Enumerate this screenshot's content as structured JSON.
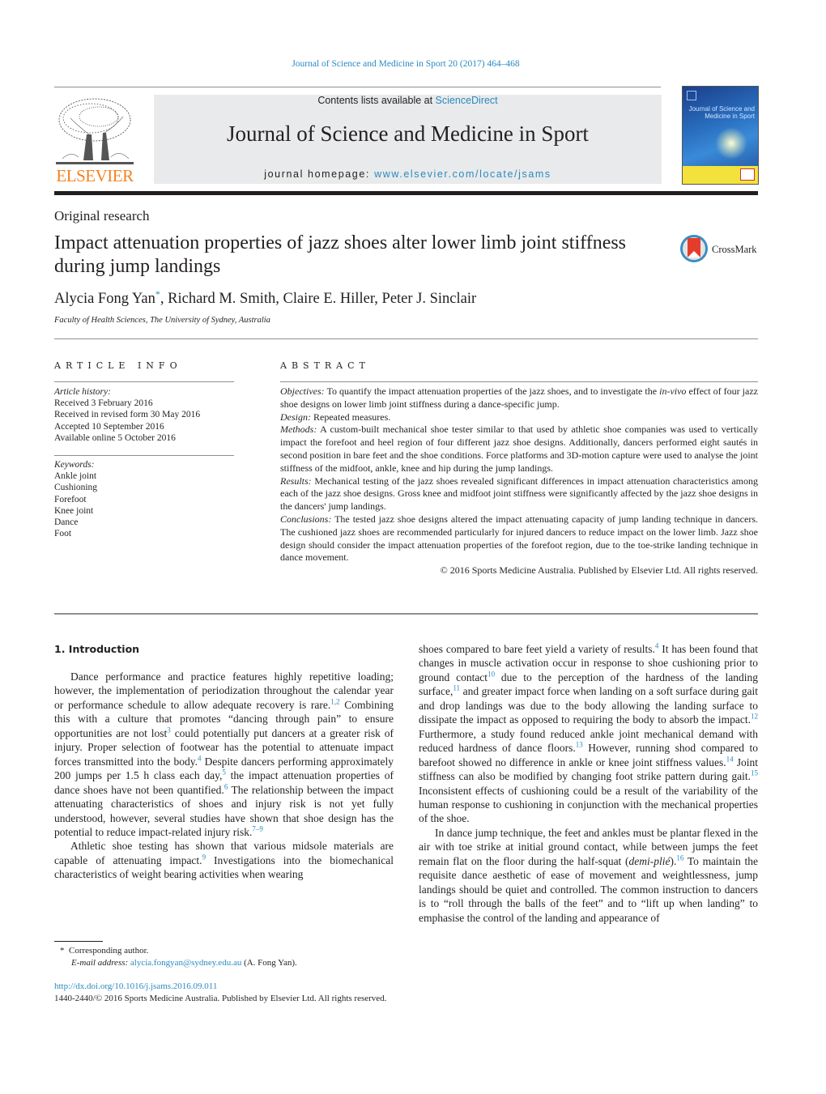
{
  "header": {
    "citation": "Journal of Science and Medicine in Sport 20 (2017) 464–468",
    "publisher_logo_text": "ELSEVIER",
    "contents_prefix": "Contents lists available at ",
    "contents_link": "ScienceDirect",
    "journal_title": "Journal of Science and Medicine in Sport",
    "homepage_prefix": "journal homepage: ",
    "homepage_link": "www.elsevier.com/locate/jsams",
    "cover_title": "Journal of Science and Medicine in Sport"
  },
  "article": {
    "type": "Original research",
    "title": "Impact attenuation properties of jazz shoes alter lower limb joint stiffness during jump landings",
    "crossmark_label": "CrossMark",
    "authors": {
      "first": "Alycia Fong Yan",
      "corresponding_mark": "*",
      "rest": ", Richard M. Smith, Claire E. Hiller, Peter J. Sinclair"
    },
    "affiliation": "Faculty of Health Sciences, The University of Sydney, Australia"
  },
  "article_info": {
    "heading": "ARTICLE INFO",
    "history_label": "Article history:",
    "history": [
      "Received 3 February 2016",
      "Received in revised form 30 May 2016",
      "Accepted 10 September 2016",
      "Available online 5 October 2016"
    ],
    "keywords_label": "Keywords:",
    "keywords": [
      "Ankle joint",
      "Cushioning",
      "Forefoot",
      "Knee joint",
      "Dance",
      "Foot"
    ]
  },
  "abstract": {
    "heading": "ABSTRACT",
    "objectives_label": "Objectives:",
    "objectives_a": " To quantify the impact attenuation properties of the jazz shoes, and to investigate the ",
    "objectives_italic": "in-vivo",
    "objectives_b": " effect of four jazz shoe designs on lower limb joint stiffness during a dance-specific jump.",
    "design_label": "Design:",
    "design": " Repeated measures.",
    "methods_label": "Methods:",
    "methods": " A custom-built mechanical shoe tester similar to that used by athletic shoe companies was used to vertically impact the forefoot and heel region of four different jazz shoe designs. Additionally, dancers performed eight sautés in second position in bare feet and the shoe conditions. Force platforms and 3D-motion capture were used to analyse the joint stiffness of the midfoot, ankle, knee and hip during the jump landings.",
    "results_label": "Results:",
    "results": " Mechanical testing of the jazz shoes revealed significant differences in impact attenuation characteristics among each of the jazz shoe designs. Gross knee and midfoot joint stiffness were significantly affected by the jazz shoe designs in the dancers' jump landings.",
    "conclusions_label": "Conclusions:",
    "conclusions": " The tested jazz shoe designs altered the impact attenuating capacity of jump landing technique in dancers. The cushioned jazz shoes are recommended particularly for injured dancers to reduce impact on the lower limb. Jazz shoe design should consider the impact attenuation properties of the forefoot region, due to the toe-strike landing technique in dance movement.",
    "copyright": "© 2016 Sports Medicine Australia. Published by Elsevier Ltd. All rights reserved."
  },
  "body": {
    "section_heading": "1.  Introduction",
    "p1": {
      "s1": "Dance performance and practice features highly repetitive loading; however, the implementation of periodization throughout the calendar year or performance schedule to allow adequate recovery is rare.",
      "r1": "1,2",
      "s2": " Combining this with a culture that promotes “dancing through pain” to ensure opportunities are not lost",
      "r2": "3",
      "s3": " could potentially put dancers at a greater risk of injury. Proper selection of footwear has the potential to attenuate impact forces transmitted into the body.",
      "r3": "4",
      "s4": " Despite dancers performing approximately 200 jumps per 1.5 h class each day,",
      "r4": "5",
      "s5": " the impact attenuation properties of dance shoes have not been quantified.",
      "r5": "6",
      "s6": " The relationship between the impact attenuating characteristics of shoes and injury risk is not yet fully understood, however, several studies have shown that shoe design has the potential to reduce impact-related injury risk.",
      "r6": "7–9"
    },
    "p2": {
      "s1": "Athletic shoe testing has shown that various midsole materials are capable of attenuating impact.",
      "r1": "9",
      "s2": " Investigations into the biomechanical characteristics of weight bearing activities when wearing"
    },
    "p2_cont": {
      "s1": "shoes compared to bare feet yield a variety of results.",
      "r1": "4",
      "s2": " It has been found that changes in muscle activation occur in response to shoe cushioning prior to ground contact",
      "r2": "10",
      "s3": " due to the perception of the hardness of the landing surface,",
      "r3": "11",
      "s4": " and greater impact force when landing on a soft surface during gait and drop landings was due to the body allowing the landing surface to dissipate the impact as opposed to requiring the body to absorb the impact.",
      "r4": "12",
      "s5": " Furthermore, a study found reduced ankle joint mechanical demand with reduced hardness of dance floors.",
      "r5": "13",
      "s6": " However, running shod compared to barefoot showed no difference in ankle or knee joint stiffness values.",
      "r6": "14",
      "s7": " Joint stiffness can also be modified by changing foot strike pattern during gait.",
      "r7": "15",
      "s8": " Inconsistent effects of cushioning could be a result of the variability of the human response to cushioning in conjunction with the mechanical properties of the shoe."
    },
    "p3": {
      "s1": "In dance jump technique, the feet and ankles must be plantar flexed in the air with toe strike at initial ground contact, while between jumps the feet remain flat on the floor during the half-squat (",
      "italic": "demi-plié",
      "s2": ").",
      "r1": "16",
      "s3": " To maintain the requisite dance aesthetic of ease of movement and weightlessness, jump landings should be quiet and controlled. The common instruction to dancers is to “roll through the balls of the feet” and to “lift up when landing” to emphasise the control of the landing and appearance of"
    }
  },
  "footnotes": {
    "mark": "*",
    "corresponding": "Corresponding author.",
    "email_label": "E-mail address:",
    "email": "alycia.fongyan@sydney.edu.au",
    "email_suffix": " (A. Fong Yan).",
    "doi": "http://dx.doi.org/10.1016/j.jsams.2016.09.011",
    "issn_line": "1440-2440/© 2016 Sports Medicine Australia. Published by Elsevier Ltd. All rights reserved."
  },
  "colors": {
    "link": "#2a8ac0",
    "elsevier_orange": "#f58220",
    "banner_bg": "#e9eaeb",
    "text": "#231f20"
  }
}
